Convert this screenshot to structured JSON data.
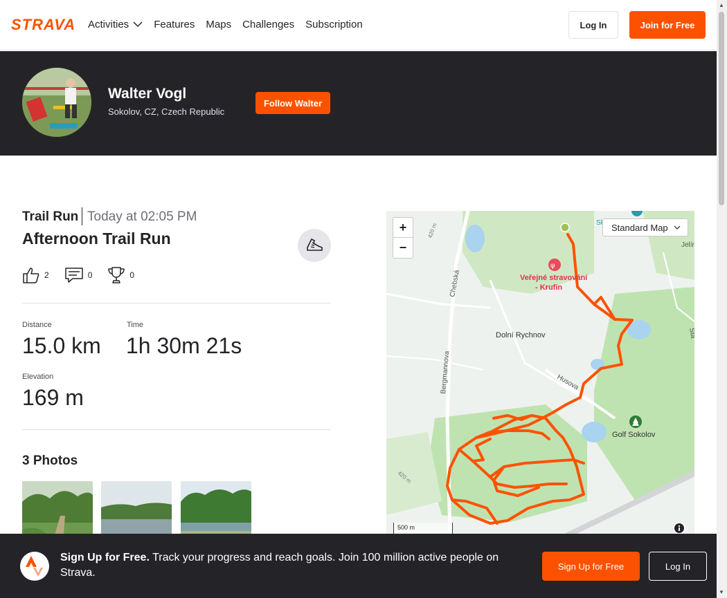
{
  "nav": {
    "logo_text": "STRAVA",
    "links": [
      {
        "label": "Activities",
        "has_dropdown": true
      },
      {
        "label": "Features"
      },
      {
        "label": "Maps"
      },
      {
        "label": "Challenges"
      },
      {
        "label": "Subscription"
      }
    ],
    "login_label": "Log In",
    "join_label": "Join for Free"
  },
  "athlete": {
    "name": "Walter Vogl",
    "location": "Sokolov, CZ, Czech Republic",
    "follow_label": "Follow Walter"
  },
  "activity": {
    "type": "Trail Run",
    "date": "Today at 02:05 PM",
    "title": "Afternoon Trail Run",
    "kudos_count": "2",
    "comments_count": "0",
    "achievements_count": "0",
    "stats": {
      "distance_label": "Distance",
      "distance_value": "15.0 km",
      "time_label": "Time",
      "time_value": "1h 30m 21s",
      "elevation_label": "Elevation",
      "elevation_value": "169 m"
    },
    "photos_title": "3 Photos"
  },
  "map": {
    "style_label": "Standard Map",
    "zoom_in": "+",
    "zoom_out": "−",
    "scale_label": "500 m",
    "place_labels": {
      "restaurant": "Veřejné stravování",
      "restaurant2": "- Krufin",
      "village": "Dolní Rychnov",
      "golf": "Golf Sokolov",
      "street1": "Chebská",
      "street2": "Bergmannova",
      "street3": "Husova",
      "contour1": "420 m",
      "contour2": "420 m",
      "edge1": "Jelín",
      "edge2": "Sta",
      "edge3": "Sk"
    },
    "colors": {
      "route": "#fc5200",
      "water": "#a9d3ef",
      "park": "#bfe3b0"
    }
  },
  "signup": {
    "headline": "Sign Up for Free.",
    "text": "Track your progress and reach goals. Join 100 million active people on Strava.",
    "signup_label": "Sign Up for Free",
    "login_label": "Log In"
  },
  "colors": {
    "brand": "#fc5200",
    "dark": "#242428"
  }
}
